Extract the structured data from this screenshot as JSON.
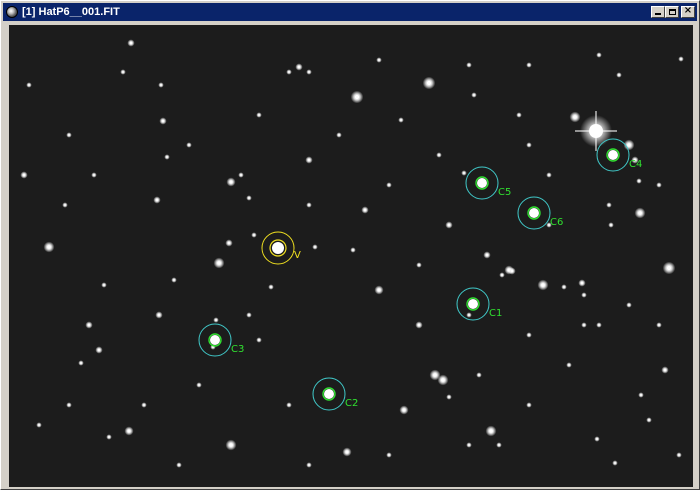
{
  "window": {
    "title": "[1] HatP6__001.FIT",
    "icon": "telescope-app-icon",
    "controls": [
      "minimize",
      "maximize",
      "close"
    ],
    "close_glyph": "×"
  },
  "image": {
    "background_color": "#1c1c1c",
    "target": {
      "label": "V",
      "color": "#f0e020"
    },
    "comparisons": [
      {
        "label": "C1"
      },
      {
        "label": "C2"
      },
      {
        "label": "C3"
      },
      {
        "label": "C4"
      },
      {
        "label": "C5"
      },
      {
        "label": "C6"
      }
    ],
    "comparison_ring_color": "#40c8c8",
    "comparison_label_color": "#30e030"
  }
}
